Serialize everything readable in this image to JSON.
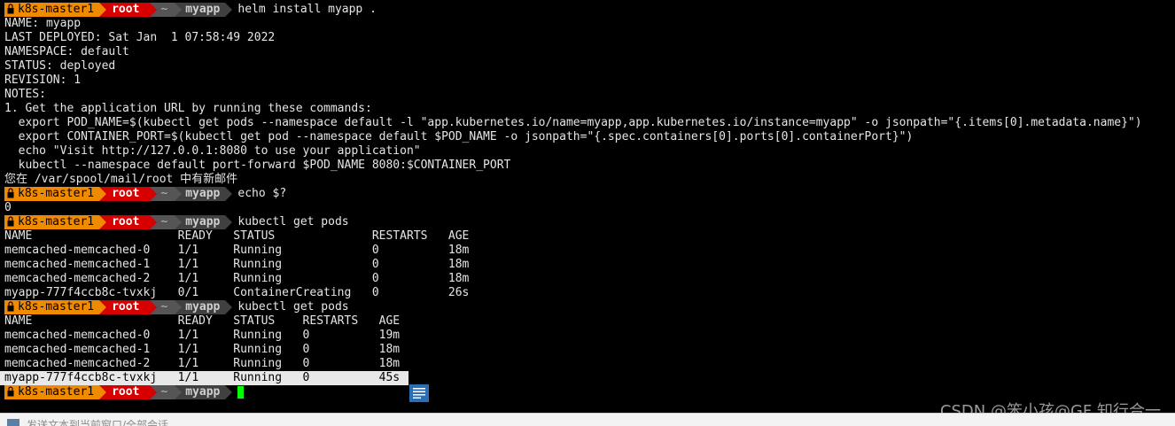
{
  "prompt": {
    "host": "k8s-master1",
    "user": "root",
    "tilde": "~",
    "dir": "myapp"
  },
  "commands": [
    "helm install myapp .",
    "echo $?",
    "kubectl get pods",
    "kubectl get pods"
  ],
  "helm_output": [
    "NAME: myapp",
    "LAST DEPLOYED: Sat Jan  1 07:58:49 2022",
    "NAMESPACE: default",
    "STATUS: deployed",
    "REVISION: 1",
    "NOTES:",
    "1. Get the application URL by running these commands:",
    "  export POD_NAME=$(kubectl get pods --namespace default -l \"app.kubernetes.io/name=myapp,app.kubernetes.io/instance=myapp\" -o jsonpath=\"{.items[0].metadata.name}\")",
    "  export CONTAINER_PORT=$(kubectl get pod --namespace default $POD_NAME -o jsonpath=\"{.spec.containers[0].ports[0].containerPort}\")",
    "  echo \"Visit http://127.0.0.1:8080 to use your application\"",
    "  kubectl --namespace default port-forward $POD_NAME 8080:$CONTAINER_PORT",
    "您在 /var/spool/mail/root 中有新邮件"
  ],
  "echo_output": "0",
  "pods_table_1": [
    "NAME                     READY   STATUS              RESTARTS   AGE",
    "memcached-memcached-0    1/1     Running             0          18m",
    "memcached-memcached-1    1/1     Running             0          18m",
    "memcached-memcached-2    1/1     Running             0          18m",
    "myapp-777f4ccb8c-tvxkj   0/1     ContainerCreating   0          26s"
  ],
  "pods_table_2": [
    "NAME                     READY   STATUS    RESTARTS   AGE",
    "memcached-memcached-0    1/1     Running   0          19m",
    "memcached-memcached-1    1/1     Running   0          18m",
    "memcached-memcached-2    1/1     Running   0          18m",
    "myapp-777f4ccb8c-tvxkj   1/1     Running   0          45s"
  ],
  "watermark": "CSDN @笨小孩@GF 知行合一",
  "statusbar_text": "发送文本到当前窗口/全部会话",
  "colors": {
    "host_segment": "#f08a00",
    "user_segment": "#d70000",
    "cursor": "#00ff00",
    "background": "#000000"
  },
  "icons": {
    "prompt_lock": "lock-icon",
    "note": "note-icon"
  }
}
